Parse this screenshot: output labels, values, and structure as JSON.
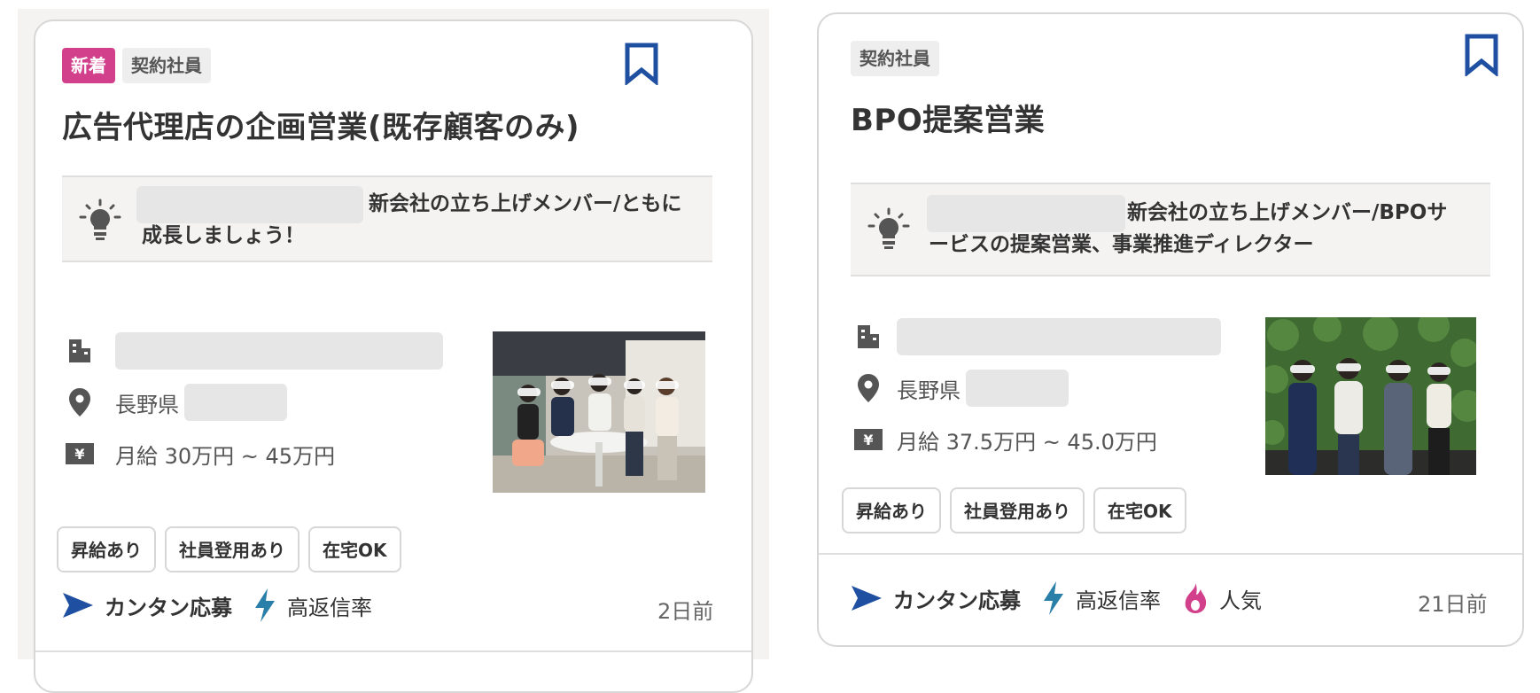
{
  "colors": {
    "accent_blue": "#1f4fa0",
    "new_badge": "#d2408c",
    "flame": "#d2408c",
    "bolt": "#2a7fa8"
  },
  "cards": [
    {
      "badges": {
        "new": "新着",
        "type": "契約社員"
      },
      "title": "広告代理店の企画営業(既存顧客のみ)",
      "catch": "新会社の立ち上げメンバー/ともに",
      "catch_line2": "成長しましょう！",
      "location": "長野県",
      "salary": "月給 30万円 ~ 45万円",
      "tags": [
        "昇給あり",
        "社員登用あり",
        "在宅OK"
      ],
      "features": {
        "easy_apply": "カンタン応募",
        "reply_rate": "高返信率"
      },
      "date": "2日前"
    },
    {
      "badges": {
        "type": "契約社員"
      },
      "title": "BPO提案営業",
      "catch": "新会社の立ち上げメンバー/BPOサ",
      "catch_line2": "ービスの提案営業、事業推進ディレクター",
      "location": "長野県",
      "salary": "月給 37.5万円 ~ 45.0万円",
      "tags": [
        "昇給あり",
        "社員登用あり",
        "在宅OK"
      ],
      "features": {
        "easy_apply": "カンタン応募",
        "reply_rate": "高返信率",
        "popular": "人気"
      },
      "date": "21日前"
    }
  ],
  "icons": {
    "bookmark": "bookmark-icon",
    "bulb": "lightbulb-icon",
    "company": "building-icon",
    "location": "map-pin-icon",
    "salary": "yen-icon",
    "apply": "send-arrow-icon",
    "reply": "lightning-icon",
    "popular": "flame-icon"
  }
}
